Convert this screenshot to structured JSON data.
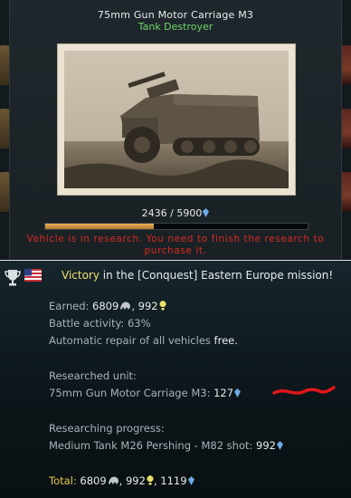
{
  "vehicle": {
    "name": "75mm Gun Motor Carriage M3",
    "class": "Tank Destroyer",
    "research_progress_text": "2436 / 5900",
    "research_fraction": 0.413,
    "warning": "Vehicle is in research. You need to finish the research to purchase it."
  },
  "report": {
    "result_word": "Victory",
    "headline_rest": " in the [Conquest] Eastern Europe mission!",
    "earned_label": "Earned:",
    "earned_silver": "6809",
    "earned_rp": "992",
    "battle_activity": "Battle activity: 63%",
    "repair_text": "Automatic repair of all vehicles",
    "repair_value": "free.",
    "researched_unit_label": "Researched unit:",
    "researched_unit_name": "75mm Gun Motor Carriage M3:",
    "researched_unit_rp": "127",
    "researching_label": "Researching progress:",
    "researching_item": "Medium Tank M26 Pershing - M82 shot:",
    "researching_rp": "992",
    "total_label": "Total:",
    "total_silver": "6809",
    "total_rp": "992",
    "total_rp2": "1119"
  },
  "colors": {
    "victory": "#f0e070",
    "class": "#6fd36a",
    "warning": "#d62a20",
    "progress": "#e9b25a",
    "convertible_rp": "#6fa9e6"
  },
  "icons": [
    "trophy-icon",
    "usa-flag-icon",
    "silver-lions-icon",
    "research-points-icon",
    "convertible-rp-icon"
  ]
}
